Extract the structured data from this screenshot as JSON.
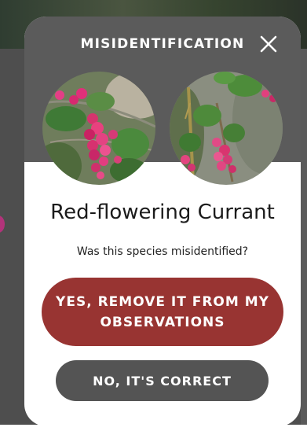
{
  "modal": {
    "title": "MISIDENTIFICATION",
    "close_icon": "close-icon",
    "species_name": "Red-flowering Currant",
    "question": "Was this species misidentified?",
    "remove_button_label": "YES, REMOVE IT FROM MY OBSERVATIONS",
    "correct_button_label": "NO, IT'S CORRECT"
  },
  "colors": {
    "header_background": "#5b5b5b",
    "remove_button": "#983432",
    "correct_button": "#545454",
    "modal_background": "#ffffff"
  }
}
